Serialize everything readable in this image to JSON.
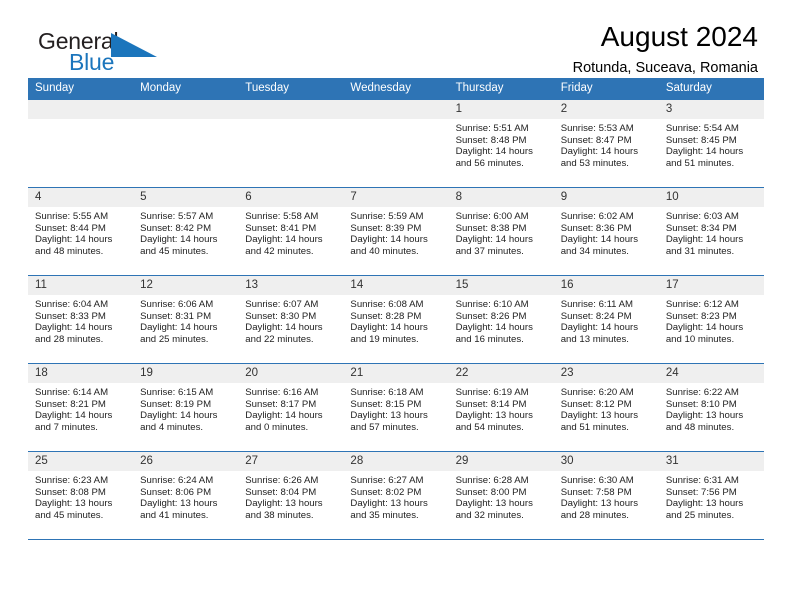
{
  "brand": {
    "name_top": "General",
    "name_bottom": "Blue",
    "flag_icon": "blue-flag-triangle",
    "color_dark": "#231f20",
    "color_blue": "#1b75bc"
  },
  "header": {
    "title": "August 2024",
    "subtitle": "Rotunda, Suceava, Romania"
  },
  "theme": {
    "header_bar": "#2e74b5",
    "day_number_band": "#efefef",
    "cell_background": "#ffffff"
  },
  "calendar": {
    "weekday_headers": [
      "Sunday",
      "Monday",
      "Tuesday",
      "Wednesday",
      "Thursday",
      "Friday",
      "Saturday"
    ],
    "weeks": [
      [
        {
          "day": "",
          "lines": []
        },
        {
          "day": "",
          "lines": []
        },
        {
          "day": "",
          "lines": []
        },
        {
          "day": "",
          "lines": []
        },
        {
          "day": "1",
          "lines": [
            "Sunrise: 5:51 AM",
            "Sunset: 8:48 PM",
            "Daylight: 14 hours",
            "and 56 minutes."
          ]
        },
        {
          "day": "2",
          "lines": [
            "Sunrise: 5:53 AM",
            "Sunset: 8:47 PM",
            "Daylight: 14 hours",
            "and 53 minutes."
          ]
        },
        {
          "day": "3",
          "lines": [
            "Sunrise: 5:54 AM",
            "Sunset: 8:45 PM",
            "Daylight: 14 hours",
            "and 51 minutes."
          ]
        }
      ],
      [
        {
          "day": "4",
          "lines": [
            "Sunrise: 5:55 AM",
            "Sunset: 8:44 PM",
            "Daylight: 14 hours",
            "and 48 minutes."
          ]
        },
        {
          "day": "5",
          "lines": [
            "Sunrise: 5:57 AM",
            "Sunset: 8:42 PM",
            "Daylight: 14 hours",
            "and 45 minutes."
          ]
        },
        {
          "day": "6",
          "lines": [
            "Sunrise: 5:58 AM",
            "Sunset: 8:41 PM",
            "Daylight: 14 hours",
            "and 42 minutes."
          ]
        },
        {
          "day": "7",
          "lines": [
            "Sunrise: 5:59 AM",
            "Sunset: 8:39 PM",
            "Daylight: 14 hours",
            "and 40 minutes."
          ]
        },
        {
          "day": "8",
          "lines": [
            "Sunrise: 6:00 AM",
            "Sunset: 8:38 PM",
            "Daylight: 14 hours",
            "and 37 minutes."
          ]
        },
        {
          "day": "9",
          "lines": [
            "Sunrise: 6:02 AM",
            "Sunset: 8:36 PM",
            "Daylight: 14 hours",
            "and 34 minutes."
          ]
        },
        {
          "day": "10",
          "lines": [
            "Sunrise: 6:03 AM",
            "Sunset: 8:34 PM",
            "Daylight: 14 hours",
            "and 31 minutes."
          ]
        }
      ],
      [
        {
          "day": "11",
          "lines": [
            "Sunrise: 6:04 AM",
            "Sunset: 8:33 PM",
            "Daylight: 14 hours",
            "and 28 minutes."
          ]
        },
        {
          "day": "12",
          "lines": [
            "Sunrise: 6:06 AM",
            "Sunset: 8:31 PM",
            "Daylight: 14 hours",
            "and 25 minutes."
          ]
        },
        {
          "day": "13",
          "lines": [
            "Sunrise: 6:07 AM",
            "Sunset: 8:30 PM",
            "Daylight: 14 hours",
            "and 22 minutes."
          ]
        },
        {
          "day": "14",
          "lines": [
            "Sunrise: 6:08 AM",
            "Sunset: 8:28 PM",
            "Daylight: 14 hours",
            "and 19 minutes."
          ]
        },
        {
          "day": "15",
          "lines": [
            "Sunrise: 6:10 AM",
            "Sunset: 8:26 PM",
            "Daylight: 14 hours",
            "and 16 minutes."
          ]
        },
        {
          "day": "16",
          "lines": [
            "Sunrise: 6:11 AM",
            "Sunset: 8:24 PM",
            "Daylight: 14 hours",
            "and 13 minutes."
          ]
        },
        {
          "day": "17",
          "lines": [
            "Sunrise: 6:12 AM",
            "Sunset: 8:23 PM",
            "Daylight: 14 hours",
            "and 10 minutes."
          ]
        }
      ],
      [
        {
          "day": "18",
          "lines": [
            "Sunrise: 6:14 AM",
            "Sunset: 8:21 PM",
            "Daylight: 14 hours",
            "and 7 minutes."
          ]
        },
        {
          "day": "19",
          "lines": [
            "Sunrise: 6:15 AM",
            "Sunset: 8:19 PM",
            "Daylight: 14 hours",
            "and 4 minutes."
          ]
        },
        {
          "day": "20",
          "lines": [
            "Sunrise: 6:16 AM",
            "Sunset: 8:17 PM",
            "Daylight: 14 hours",
            "and 0 minutes."
          ]
        },
        {
          "day": "21",
          "lines": [
            "Sunrise: 6:18 AM",
            "Sunset: 8:15 PM",
            "Daylight: 13 hours",
            "and 57 minutes."
          ]
        },
        {
          "day": "22",
          "lines": [
            "Sunrise: 6:19 AM",
            "Sunset: 8:14 PM",
            "Daylight: 13 hours",
            "and 54 minutes."
          ]
        },
        {
          "day": "23",
          "lines": [
            "Sunrise: 6:20 AM",
            "Sunset: 8:12 PM",
            "Daylight: 13 hours",
            "and 51 minutes."
          ]
        },
        {
          "day": "24",
          "lines": [
            "Sunrise: 6:22 AM",
            "Sunset: 8:10 PM",
            "Daylight: 13 hours",
            "and 48 minutes."
          ]
        }
      ],
      [
        {
          "day": "25",
          "lines": [
            "Sunrise: 6:23 AM",
            "Sunset: 8:08 PM",
            "Daylight: 13 hours",
            "and 45 minutes."
          ]
        },
        {
          "day": "26",
          "lines": [
            "Sunrise: 6:24 AM",
            "Sunset: 8:06 PM",
            "Daylight: 13 hours",
            "and 41 minutes."
          ]
        },
        {
          "day": "27",
          "lines": [
            "Sunrise: 6:26 AM",
            "Sunset: 8:04 PM",
            "Daylight: 13 hours",
            "and 38 minutes."
          ]
        },
        {
          "day": "28",
          "lines": [
            "Sunrise: 6:27 AM",
            "Sunset: 8:02 PM",
            "Daylight: 13 hours",
            "and 35 minutes."
          ]
        },
        {
          "day": "29",
          "lines": [
            "Sunrise: 6:28 AM",
            "Sunset: 8:00 PM",
            "Daylight: 13 hours",
            "and 32 minutes."
          ]
        },
        {
          "day": "30",
          "lines": [
            "Sunrise: 6:30 AM",
            "Sunset: 7:58 PM",
            "Daylight: 13 hours",
            "and 28 minutes."
          ]
        },
        {
          "day": "31",
          "lines": [
            "Sunrise: 6:31 AM",
            "Sunset: 7:56 PM",
            "Daylight: 13 hours",
            "and 25 minutes."
          ]
        }
      ]
    ]
  }
}
